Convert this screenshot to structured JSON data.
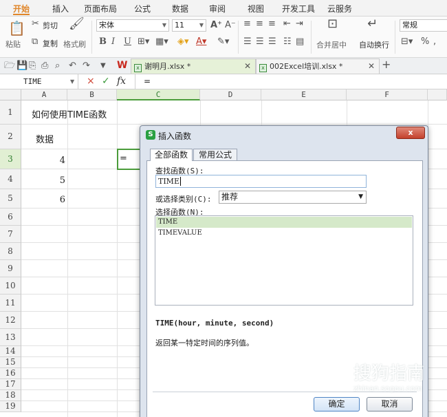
{
  "ribbon_tabs": [
    "开始",
    "插入",
    "页面布局",
    "公式",
    "数据",
    "审阅",
    "视图",
    "开发工具",
    "云服务"
  ],
  "ribbon": {
    "paste": "粘贴",
    "cut": "剪切",
    "copy": "复制",
    "format_painter": "格式刷",
    "font_name": "宋体",
    "font_size": "11",
    "bold": "B",
    "italic": "I",
    "underline": "U",
    "merge_center": "合并居中",
    "wrap_text": "自动换行",
    "number_format": "常规",
    "percent": "%"
  },
  "doc_tabs": [
    {
      "label": "谢明月.xlsx *",
      "icon": "wps-logo-icon",
      "active": true
    },
    {
      "label": "002Excel培训.xlsx *",
      "icon": "xlsx-file-icon",
      "active": false
    }
  ],
  "formula_bar": {
    "name_box": "TIME",
    "cancel": "×",
    "confirm": "✓",
    "fx": "fx",
    "content": "="
  },
  "grid": {
    "columns": [
      "A",
      "B",
      "C",
      "D",
      "E",
      "F"
    ],
    "rows": [
      "1",
      "2",
      "3",
      "4",
      "5",
      "6",
      "7",
      "8",
      "9",
      "10",
      "11",
      "12",
      "13",
      "14",
      "15",
      "16",
      "17",
      "18",
      "19"
    ],
    "cells": {
      "A1": "如何使用TIME函数",
      "A2": "数据",
      "A3": "4",
      "A4": "5",
      "A5": "6",
      "C3": "="
    }
  },
  "dialog": {
    "title": "插入函数",
    "close_label": "x",
    "tab_all": "全部函数",
    "tab_common": "常用公式",
    "search_label": "查找函数(S):",
    "search_value": "TIME",
    "category_label": "或选择类别(C):",
    "category_value": "推荐",
    "function_label": "选择函数(N):",
    "functions": [
      "TIME",
      "TIMEVALUE"
    ],
    "selected_function": "TIME",
    "signature": "TIME(hour, minute, second)",
    "description": "返回某一特定时间的序列值。",
    "ok": "确定",
    "cancel": "取消"
  },
  "watermark": {
    "text": "搜狗指南",
    "sub": "zhinan.sogou.com"
  },
  "colors": {
    "accent": "#e0862a",
    "selection_green": "#4a9c3a",
    "selected_item": "#d5e9c9"
  }
}
